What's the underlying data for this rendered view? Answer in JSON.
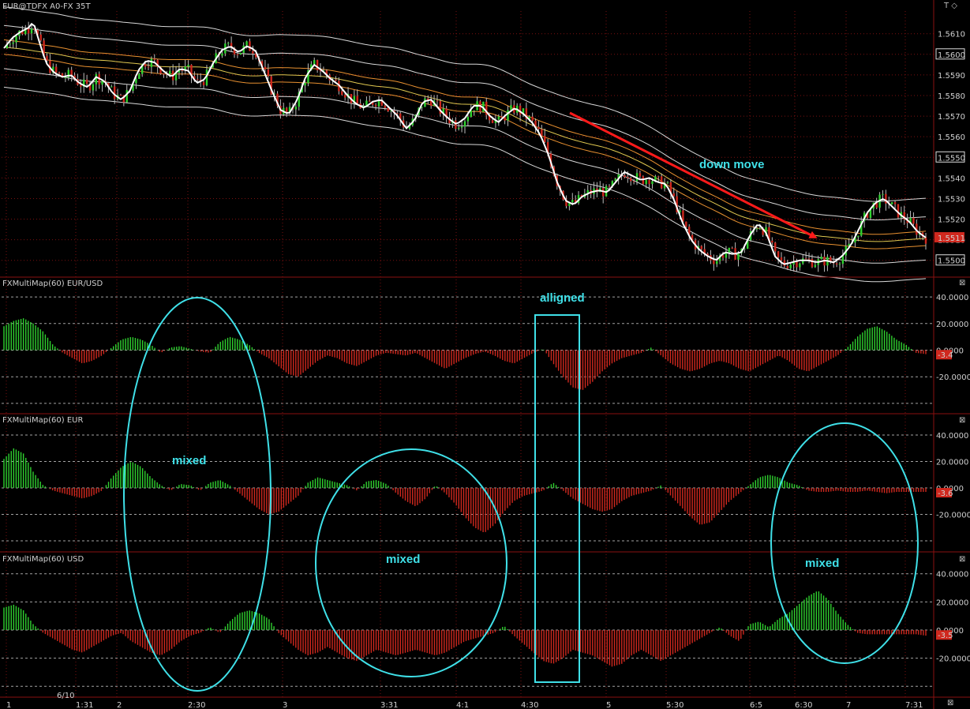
{
  "window": {
    "symbol_title": "EUR@TDFX A0-FX 35T",
    "top_right_controls": "T ◇",
    "close_glyph": "⊠"
  },
  "colors": {
    "background": "#000000",
    "up": "#2fd12f",
    "down": "#d0281e",
    "annotation": "#3fe0e8",
    "arrow": "#ff1a1a",
    "grid": "#7a1010"
  },
  "chart_data": [
    {
      "type": "candlestick",
      "title": "EUR@TDFX A0-FX 35T",
      "ylim": [
        1.5493,
        1.5621
      ],
      "y_ticks": [
        "1.5610",
        "1.5600",
        "1.5590",
        "1.5580",
        "1.5570",
        "1.5560",
        "1.5550",
        "1.5540",
        "1.5530",
        "1.5520",
        "1.5510",
        "1.5500"
      ],
      "boxed_ticks": [
        "1.5600",
        "1.5550",
        "1.5500"
      ],
      "last_price": "1.5511",
      "close_path": [
        [
          0,
          1.5603
        ],
        [
          1,
          1.5608
        ],
        [
          2,
          1.5611
        ],
        [
          3,
          1.5613
        ],
        [
          3.5,
          1.5616
        ],
        [
          4,
          1.5609
        ],
        [
          5,
          1.5596
        ],
        [
          6,
          1.5591
        ],
        [
          7,
          1.5589
        ],
        [
          8,
          1.559
        ],
        [
          9,
          1.5586
        ],
        [
          10,
          1.5584
        ],
        [
          11,
          1.5589
        ],
        [
          12,
          1.5587
        ],
        [
          13,
          1.5581
        ],
        [
          14,
          1.5578
        ],
        [
          15,
          1.5582
        ],
        [
          16,
          1.5592
        ],
        [
          17,
          1.5597
        ],
        [
          18,
          1.5596
        ],
        [
          19,
          1.5592
        ],
        [
          20,
          1.5589
        ],
        [
          21,
          1.5593
        ],
        [
          22,
          1.5592
        ],
        [
          23,
          1.5586
        ],
        [
          24,
          1.5588
        ],
        [
          25,
          1.5596
        ],
        [
          26,
          1.5602
        ],
        [
          27,
          1.5604
        ],
        [
          28,
          1.5601
        ],
        [
          29,
          1.5604
        ],
        [
          30,
          1.5602
        ],
        [
          31,
          1.5592
        ],
        [
          32,
          1.5582
        ],
        [
          33,
          1.5573
        ],
        [
          34,
          1.5571
        ],
        [
          35,
          1.5578
        ],
        [
          36,
          1.5589
        ],
        [
          37,
          1.5595
        ],
        [
          38,
          1.5592
        ],
        [
          39,
          1.5588
        ],
        [
          40,
          1.5585
        ],
        [
          41,
          1.558
        ],
        [
          42,
          1.5576
        ],
        [
          43,
          1.5574
        ],
        [
          44,
          1.5577
        ],
        [
          45,
          1.5578
        ],
        [
          46,
          1.5574
        ],
        [
          47,
          1.557
        ],
        [
          48,
          1.5564
        ],
        [
          49,
          1.5568
        ],
        [
          50,
          1.5577
        ],
        [
          51,
          1.5578
        ],
        [
          52,
          1.5573
        ],
        [
          53,
          1.5569
        ],
        [
          54,
          1.5566
        ],
        [
          55,
          1.5569
        ],
        [
          56,
          1.5575
        ],
        [
          57,
          1.5575
        ],
        [
          58,
          1.557
        ],
        [
          59,
          1.5567
        ],
        [
          60,
          1.5571
        ],
        [
          61,
          1.5574
        ],
        [
          62,
          1.5571
        ],
        [
          63,
          1.5567
        ],
        [
          64,
          1.5561
        ],
        [
          65,
          1.5551
        ],
        [
          66,
          1.5538
        ],
        [
          67,
          1.5529
        ],
        [
          68,
          1.5527
        ],
        [
          69,
          1.5531
        ],
        [
          70,
          1.5533
        ],
        [
          71,
          1.5534
        ],
        [
          72,
          1.5533
        ],
        [
          73,
          1.5538
        ],
        [
          74,
          1.5543
        ],
        [
          75,
          1.5541
        ],
        [
          76,
          1.5539
        ],
        [
          77,
          1.554
        ],
        [
          78,
          1.5538
        ],
        [
          79,
          1.5537
        ],
        [
          80,
          1.5529
        ],
        [
          81,
          1.5518
        ],
        [
          82,
          1.551
        ],
        [
          83,
          1.5505
        ],
        [
          84,
          1.5502
        ],
        [
          85,
          1.55
        ],
        [
          86,
          1.5504
        ],
        [
          87,
          1.5503
        ],
        [
          88,
          1.5504
        ],
        [
          89,
          1.5512
        ],
        [
          90,
          1.5518
        ],
        [
          91,
          1.5513
        ],
        [
          92,
          1.5502
        ],
        [
          93,
          1.5498
        ],
        [
          94,
          1.5499
        ],
        [
          95,
          1.55
        ],
        [
          96,
          1.55
        ],
        [
          97,
          1.5499
        ],
        [
          98,
          1.55
        ],
        [
          99,
          1.5499
        ],
        [
          100,
          1.5502
        ],
        [
          101,
          1.5507
        ],
        [
          102,
          1.5515
        ],
        [
          103,
          1.5523
        ],
        [
          104,
          1.5528
        ],
        [
          105,
          1.553
        ],
        [
          106,
          1.5526
        ],
        [
          107,
          1.5522
        ],
        [
          108,
          1.5519
        ],
        [
          109,
          1.5514
        ],
        [
          110,
          1.5511
        ]
      ],
      "bands": [
        {
          "name": "outer-upper",
          "color": "#d8d8d8",
          "offset": 0.00195
        },
        {
          "name": "mid-upper",
          "color": "#d8d8d8",
          "offset": 0.00105
        },
        {
          "name": "orange-upper",
          "color": "#e89030",
          "offset": 0.00035
        },
        {
          "name": "yellow-center",
          "color": "#e0c850",
          "offset": 0.0
        },
        {
          "name": "orange-lower",
          "color": "#e89030",
          "offset": -0.00035
        },
        {
          "name": "mid-lower",
          "color": "#d8d8d8",
          "offset": -0.00105
        },
        {
          "name": "outer-lower",
          "color": "#d8d8d8",
          "offset": -0.00195
        }
      ],
      "annotations": [
        {
          "text": "down move"
        }
      ]
    },
    {
      "type": "histogram",
      "title": "FXMultiMap(60) EUR/USD",
      "ylim": [
        -46,
        46
      ],
      "y_ticks": [
        "40.0000",
        "20.0000",
        "0.0000",
        "-20.0000"
      ],
      "last_value": "-3.4",
      "values": [
        18,
        22,
        24,
        20,
        14,
        4,
        -2,
        -6,
        -10,
        -8,
        -4,
        2,
        8,
        10,
        8,
        4,
        -2,
        2,
        3,
        1,
        -1,
        -2,
        6,
        10,
        8,
        4,
        -2,
        -6,
        -12,
        -18,
        -20,
        -14,
        -8,
        -4,
        -6,
        -10,
        -12,
        -8,
        -4,
        -2,
        -3,
        -4,
        -2,
        -6,
        -10,
        -14,
        -10,
        -6,
        -3,
        -1,
        -4,
        -8,
        -10,
        -6,
        -2,
        1,
        -10,
        -20,
        -28,
        -30,
        -24,
        -16,
        -10,
        -6,
        -4,
        -2,
        2,
        -4,
        -10,
        -14,
        -16,
        -14,
        -10,
        -8,
        -10,
        -14,
        -16,
        -12,
        -8,
        -4,
        -8,
        -14,
        -16,
        -12,
        -8,
        -4,
        2,
        10,
        16,
        18,
        14,
        8,
        4,
        -2,
        -3
      ],
      "annotations": [
        {
          "text": "alligned"
        }
      ]
    },
    {
      "type": "histogram",
      "title": "FXMultiMap(60) EUR",
      "ylim": [
        -46,
        46
      ],
      "y_ticks": [
        "40.0000",
        "20.0000",
        "0.0000",
        "-20.0000"
      ],
      "last_value": "-3.6",
      "values": [
        22,
        30,
        26,
        12,
        2,
        -2,
        -4,
        -6,
        -8,
        -6,
        -2,
        8,
        16,
        20,
        16,
        8,
        2,
        -2,
        3,
        2,
        -2,
        4,
        6,
        2,
        -4,
        -10,
        -16,
        -20,
        -18,
        -12,
        -6,
        4,
        8,
        6,
        4,
        2,
        -2,
        5,
        6,
        3,
        -4,
        -10,
        -14,
        -8,
        2,
        -4,
        -12,
        -22,
        -30,
        -34,
        -28,
        -18,
        -10,
        -6,
        -4,
        -2,
        4,
        -2,
        -8,
        -12,
        -16,
        -18,
        -16,
        -10,
        -6,
        -4,
        -2,
        2,
        -6,
        -14,
        -22,
        -28,
        -26,
        -18,
        -10,
        -4,
        2,
        8,
        10,
        8,
        4,
        2,
        -2,
        -3,
        -3,
        -2,
        -3,
        -3,
        -2,
        -3,
        -4,
        -3,
        -3,
        -3,
        -3
      ],
      "annotations": [
        {
          "text": "mixed"
        },
        {
          "text": "mixed"
        }
      ]
    },
    {
      "type": "histogram",
      "title": "FXMultiMap(60) USD",
      "ylim": [
        -46,
        46
      ],
      "y_ticks": [
        "40.0000",
        "20.0000",
        "0.0000",
        "-20.0000"
      ],
      "last_value": "-3.5",
      "values": [
        16,
        18,
        14,
        4,
        -2,
        -6,
        -10,
        -14,
        -16,
        -12,
        -8,
        -4,
        -2,
        -8,
        -12,
        -16,
        -18,
        -14,
        -8,
        -4,
        -2,
        2,
        -2,
        6,
        12,
        14,
        12,
        8,
        -2,
        -8,
        -14,
        -18,
        -16,
        -12,
        -16,
        -20,
        -22,
        -18,
        -14,
        -16,
        -18,
        -16,
        -14,
        -16,
        -18,
        -16,
        -12,
        -8,
        -6,
        -4,
        -2,
        3,
        -4,
        -10,
        -16,
        -22,
        -24,
        -20,
        -14,
        -16,
        -18,
        -22,
        -26,
        -24,
        -18,
        -14,
        -18,
        -22,
        -18,
        -14,
        -10,
        -6,
        -2,
        2,
        -4,
        -8,
        4,
        6,
        2,
        8,
        12,
        18,
        24,
        28,
        22,
        12,
        4,
        -2,
        -3,
        -3,
        -3,
        -3,
        -3,
        -3,
        -4
      ],
      "annotations": [
        {
          "text": "mixed"
        }
      ]
    }
  ],
  "x_axis": {
    "labels": [
      "1",
      "1:31",
      "2",
      "2:30",
      "3",
      "3:31",
      "4:1",
      "4:30",
      "5",
      "5:30",
      "6:5",
      "6:30",
      "7",
      "7:31"
    ],
    "date_label": "6/10"
  }
}
